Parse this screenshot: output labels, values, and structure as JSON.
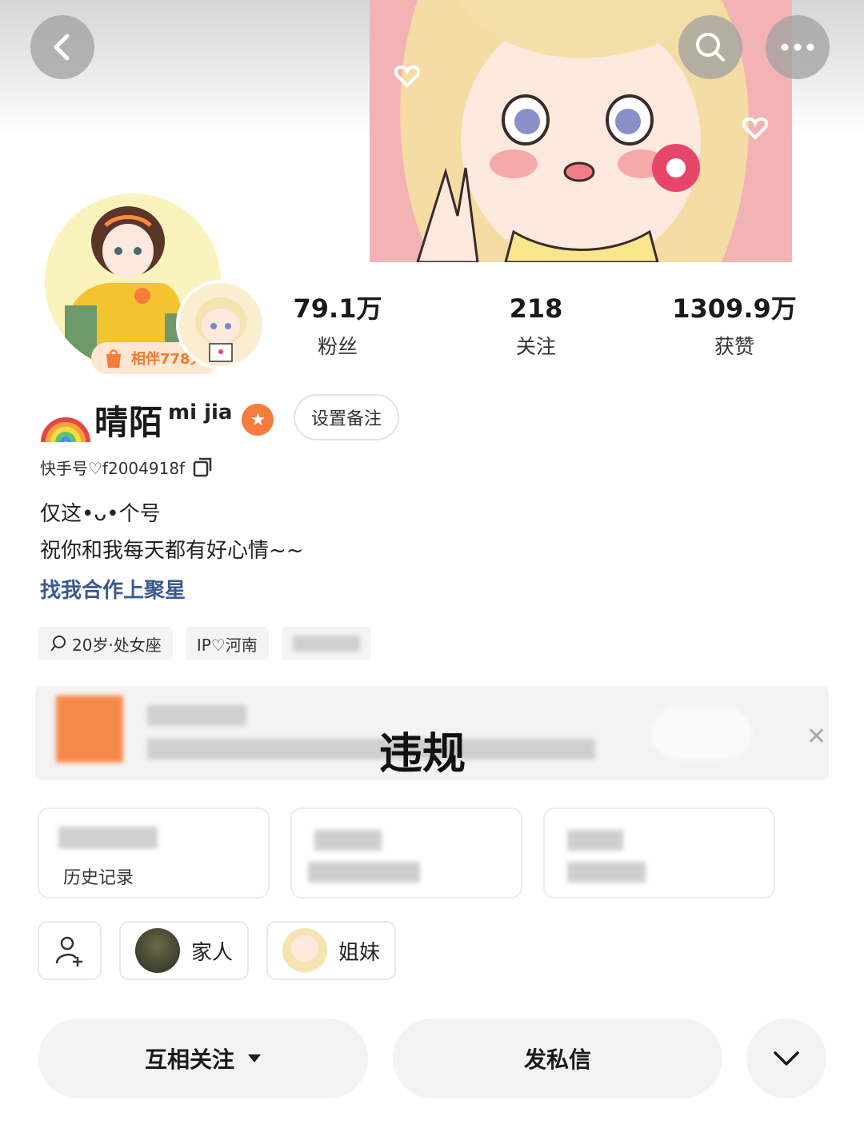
{
  "header": {
    "back_icon": "chevron-left-icon",
    "search_icon": "search-icon",
    "more_icon": "more-dots-icon"
  },
  "profile": {
    "companion_badge": "相伴778天",
    "nickname": "晴陌",
    "nickname_suffix": "mi jia",
    "remark_button": "设置备注",
    "kuaishou_id": "快手号♡f2004918f",
    "bio_lines": [
      "仅这•ᴗ•个号",
      "祝你和我每天都有好心情~~"
    ],
    "cooperate_link": "找我合作上聚星"
  },
  "stats": [
    {
      "value": "79.1万",
      "label": "粉丝"
    },
    {
      "value": "218",
      "label": "关注"
    },
    {
      "value": "1309.9万",
      "label": "获赞"
    }
  ],
  "tags": [
    "20岁·处女座",
    "IP♡河南"
  ],
  "notice": {
    "title": "违规"
  },
  "cards": [
    {
      "text": "历史记录"
    }
  ],
  "groups": [
    {
      "label": "家人"
    },
    {
      "label": "姐妹"
    }
  ],
  "actions": {
    "follow": "互相关注",
    "message": "发私信"
  },
  "colors": {
    "accent_orange": "#f47c3c",
    "link_blue": "#3a5a8f"
  }
}
